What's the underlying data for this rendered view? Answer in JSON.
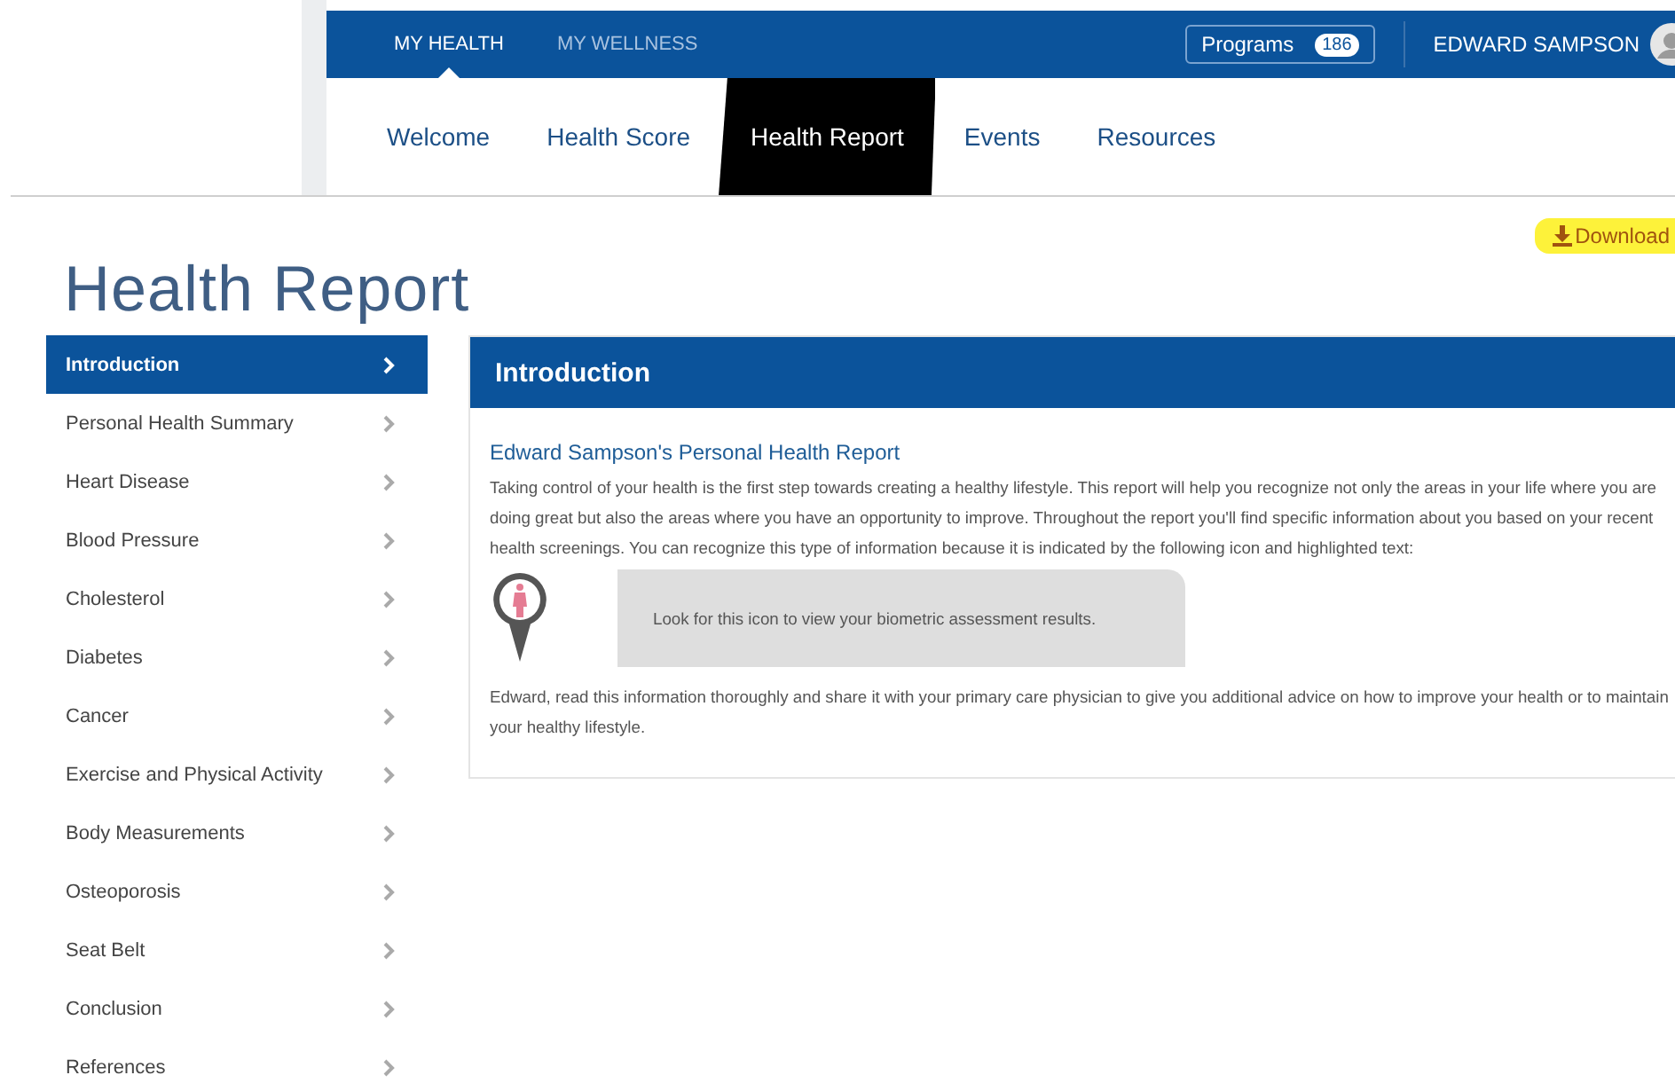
{
  "top_nav": {
    "items": [
      {
        "label": "MY HEALTH",
        "selected": true
      },
      {
        "label": "MY WELLNESS",
        "selected": false
      }
    ],
    "programs": {
      "label": "Programs",
      "count": "186"
    },
    "user": "EDWARD SAMPSON"
  },
  "sub_nav": [
    {
      "label": "Welcome",
      "selected": false
    },
    {
      "label": "Health Score",
      "selected": false
    },
    {
      "label": "Health Report",
      "selected": true
    },
    {
      "label": "Events",
      "selected": false
    },
    {
      "label": "Resources",
      "selected": false
    }
  ],
  "download": "Download",
  "page_title": "Health Report",
  "sidebar": [
    {
      "label": "Introduction",
      "selected": true
    },
    {
      "label": "Personal Health Summary",
      "selected": false
    },
    {
      "label": "Heart Disease",
      "selected": false
    },
    {
      "label": "Blood Pressure",
      "selected": false
    },
    {
      "label": "Cholesterol",
      "selected": false
    },
    {
      "label": "Diabetes",
      "selected": false
    },
    {
      "label": "Cancer",
      "selected": false
    },
    {
      "label": "Exercise and Physical Activity",
      "selected": false
    },
    {
      "label": "Body Measurements",
      "selected": false
    },
    {
      "label": "Osteoporosis",
      "selected": false
    },
    {
      "label": "Seat Belt",
      "selected": false
    },
    {
      "label": "Conclusion",
      "selected": false
    },
    {
      "label": "References",
      "selected": false
    }
  ],
  "panel": {
    "title": "Introduction",
    "heading": "Edward Sampson's Personal Health Report",
    "intro": "Taking control of your health is the first step towards creating a healthy lifestyle. This report will help you recognize not only the areas in your life where you are doing great but also the areas where you have an opportunity to improve. Throughout the report you'll find specific information about you based on your recent health screenings. You can recognize this type of information because it is indicated by the following icon and highlighted text:",
    "callout": "Look for this icon to view your biometric assessment results.",
    "closing": "Edward, read this information thoroughly and share it with your primary care physician to give you additional advice on how to improve your health or to maintain your healthy lifestyle."
  }
}
